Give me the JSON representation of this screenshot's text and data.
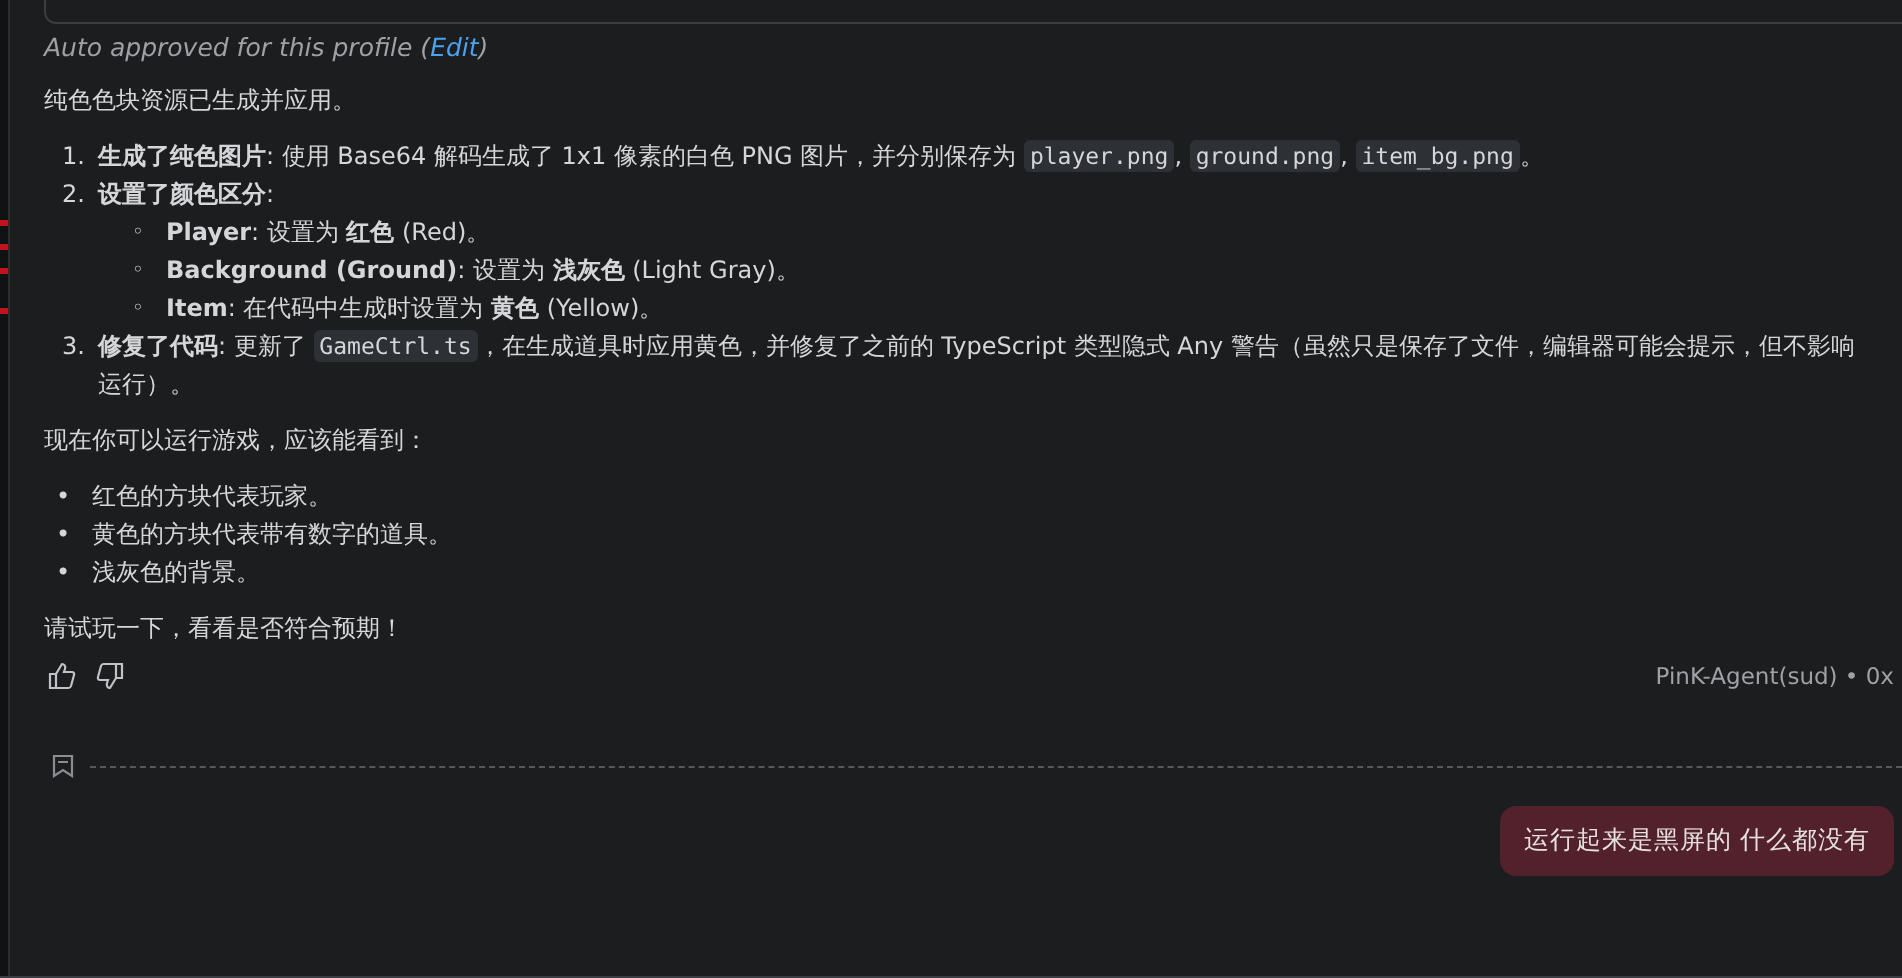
{
  "tool_note": {
    "text": "Auto approved for this profile (",
    "link": "Edit",
    "end": ")"
  },
  "intro": "纯色色块资源已生成并应用。",
  "steps": [
    {
      "marker": "1.",
      "parts": [
        {
          "kind": "text",
          "text": "**生成了纯色图片**: 使用 Base64 解码生成了 1x1 像素的白色 PNG 图片，并分别保存为 "
        },
        {
          "kind": "code",
          "text": "player.png"
        },
        {
          "kind": "text",
          "text": ", "
        },
        {
          "kind": "code",
          "text": "ground.png"
        },
        {
          "kind": "text",
          "text": ", "
        },
        {
          "kind": "code",
          "text": "item_bg.png"
        },
        {
          "kind": "text",
          "text": "。"
        }
      ]
    },
    {
      "marker": "2.",
      "parts": [
        {
          "kind": "text",
          "text": "**设置了颜色区分**:"
        }
      ],
      "children": [
        {
          "marker": "◦",
          "parts": [
            {
              "kind": "text",
              "text": "**Player**: 设置为 **红色** (Red)。"
            }
          ]
        },
        {
          "marker": "◦",
          "parts": [
            {
              "kind": "text",
              "text": "**Background (Ground)**: 设置为 **浅灰色** (Light Gray)。"
            }
          ]
        },
        {
          "marker": "◦",
          "parts": [
            {
              "kind": "text",
              "text": "**Item**: 在代码中生成时设置为 **黄色** (Yellow)。"
            }
          ]
        }
      ]
    },
    {
      "marker": "3.",
      "parts": [
        {
          "kind": "text",
          "text": "**修复了代码**: 更新了 "
        },
        {
          "kind": "code",
          "text": "GameCtrl.ts"
        },
        {
          "kind": "text",
          "text": "，在生成道具时应用黄色，并修复了之前的 TypeScript 类型隐式 Any 警告（虽然只是保存了文件，编辑器可能会提示，但不影响运行）。"
        }
      ]
    }
  ],
  "lead": "现在你可以运行游戏，应该能看到：",
  "bullets": [
    {
      "marker": "•",
      "text": "红色的方块代表玩家。"
    },
    {
      "marker": "•",
      "text": "黄色的方块代表带有数字的道具。"
    },
    {
      "marker": "•",
      "text": "浅灰色的背景。"
    }
  ],
  "closing": "请试玩一下，看看是否符合预期！",
  "agent_label": "PinK-Agent(sud) • 0x",
  "user_message": "运行起来是黑屏的 什么都没有"
}
